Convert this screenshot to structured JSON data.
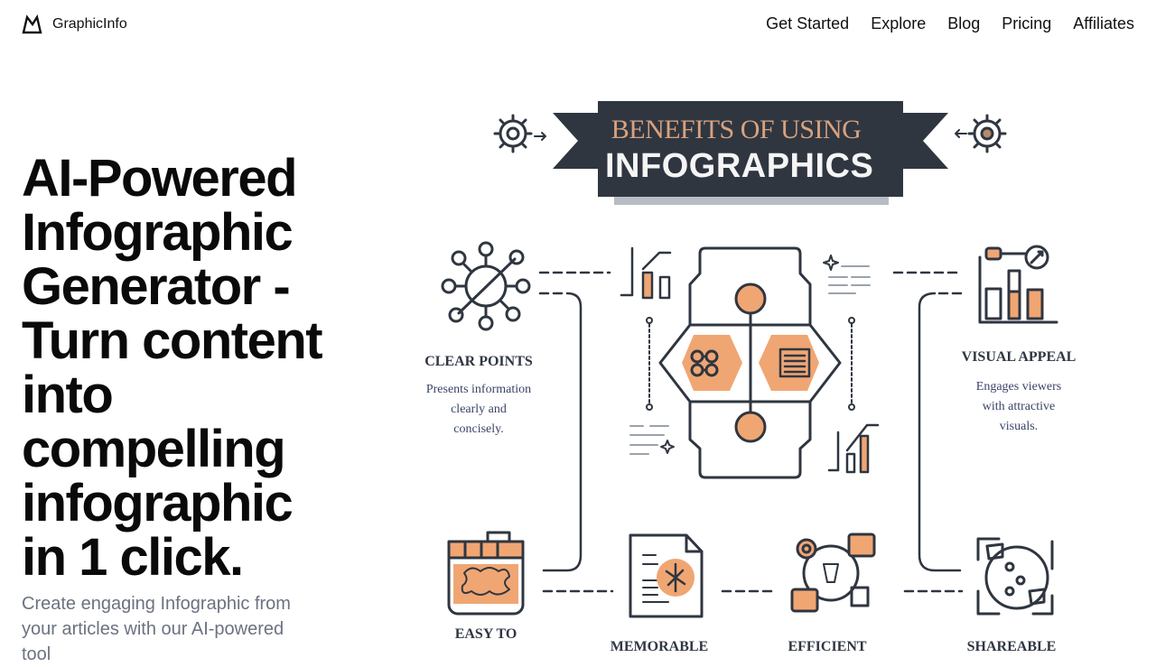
{
  "nav": {
    "brand": "GraphicInfo",
    "links": [
      "Get Started",
      "Explore",
      "Blog",
      "Pricing",
      "Affiliates"
    ]
  },
  "hero": {
    "title": "AI-Powered Infographic Generator - Turn content into compelling infographic in 1 click.",
    "subtitle": "Create engaging Infographic from your articles with our AI-powered tool"
  },
  "infographic": {
    "banner_top": "BENEFITS OF USING",
    "banner_main": "INFOGRAPHICS",
    "accent_color": "#f0a673",
    "dark_color": "#2f3640",
    "benefits": [
      {
        "title": "CLEAR POINTS",
        "desc": [
          "Presents information",
          "clearly and",
          "concisely."
        ]
      },
      {
        "title": "VISUAL APPEAL",
        "desc": [
          "Engages viewers",
          "with attractive",
          "visuals."
        ]
      },
      {
        "title": "EASY TO"
      },
      {
        "title": "MEMORABLE"
      },
      {
        "title": "EFFICIENT"
      },
      {
        "title": "SHAREABLE"
      }
    ]
  }
}
